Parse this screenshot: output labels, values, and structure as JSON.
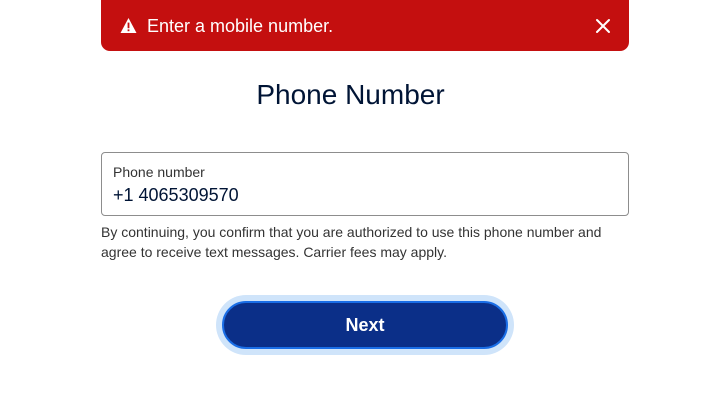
{
  "alert": {
    "icon": "warning-icon",
    "message": "Enter a mobile number.",
    "close_icon": "close-icon",
    "background_color": "#c40f0f"
  },
  "page": {
    "title": "Phone Number"
  },
  "phone_field": {
    "label": "Phone number",
    "value": "+1 4065309570"
  },
  "disclaimer": "By continuing, you confirm that you are authorized to use this phone number and agree to receive text messages. Carrier fees may apply.",
  "next_button": {
    "label": "Next",
    "color": "#0b2f88"
  }
}
